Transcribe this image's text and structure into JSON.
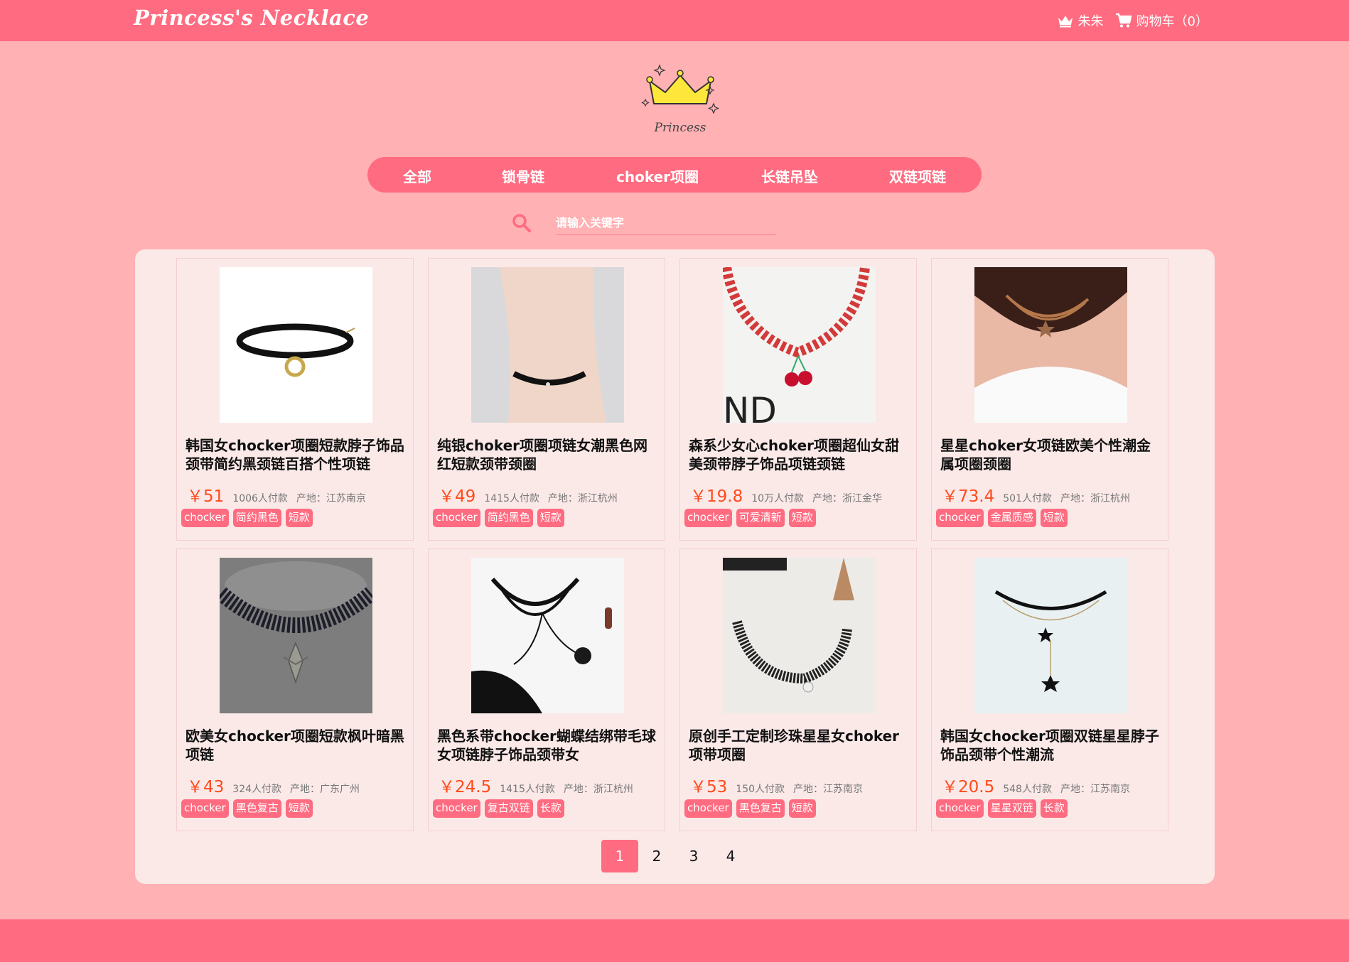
{
  "header": {
    "brand": "Princess's Necklace",
    "user_name": "朱朱",
    "cart_label": "购物车（0）"
  },
  "logo": {
    "text": "Princess"
  },
  "nav": {
    "items": [
      "全部",
      "锁骨链",
      "choker项圈",
      "长链吊坠",
      "双链项链"
    ]
  },
  "search": {
    "placeholder": "请输入关键字",
    "value": ""
  },
  "products": [
    {
      "title": "韩国女chocker项圈短款脖子饰品颈带简约黑颈链百搭个性项链",
      "price": "￥51",
      "sales": "1006人付款",
      "origin": "产地：江苏南京",
      "tags": [
        "chocker",
        "简约黑色",
        "短款"
      ]
    },
    {
      "title": "纯银choker项圈项链女潮黑色网红短款颈带颈圈",
      "price": "￥49",
      "sales": "1415人付款",
      "origin": "产地：浙江杭州",
      "tags": [
        "chocker",
        "简约黑色",
        "短款"
      ]
    },
    {
      "title": "森系少女心choker项圈超仙女甜美颈带脖子饰品项链颈链",
      "price": "￥19.8",
      "sales": "10万人付款",
      "origin": "产地：浙江金华",
      "tags": [
        "chocker",
        "可爱清新",
        "短款"
      ]
    },
    {
      "title": "星星choker女项链欧美个性潮金属项圈颈圈",
      "price": "￥73.4",
      "sales": "501人付款",
      "origin": "产地：浙江杭州",
      "tags": [
        "chocker",
        "金属质感",
        "短款"
      ]
    },
    {
      "title": "欧美女chocker项圈短款枫叶暗黑项链",
      "price": "￥43",
      "sales": "324人付款",
      "origin": "产地：广东广州",
      "tags": [
        "chocker",
        "黑色复古",
        "短款"
      ]
    },
    {
      "title": "黑色系带chocker蝴蝶结绑带毛球女项链脖子饰品颈带女",
      "price": "￥24.5",
      "sales": "1415人付款",
      "origin": "产地：浙江杭州",
      "tags": [
        "chocker",
        "复古双链",
        "长款"
      ]
    },
    {
      "title": "原创手工定制珍珠星星女choker项带项圈",
      "price": "￥53",
      "sales": "150人付款",
      "origin": "产地：江苏南京",
      "tags": [
        "chocker",
        "黑色复古",
        "短款"
      ]
    },
    {
      "title": "韩国女chocker项圈双链星星脖子饰品颈带个性潮流",
      "price": "￥20.5",
      "sales": "548人付款",
      "origin": "产地：江苏南京",
      "tags": [
        "chocker",
        "星星双链",
        "长款"
      ]
    }
  ],
  "pagination": {
    "pages": [
      "1",
      "2",
      "3",
      "4"
    ],
    "current": "1"
  },
  "colors": {
    "accent": "#ff6b80",
    "background": "#ffb1b4",
    "panel": "#fbe9e8",
    "price": "#ff4a1c"
  },
  "icons": {
    "user": "crown-icon",
    "cart": "cart-icon",
    "search": "search-icon"
  }
}
